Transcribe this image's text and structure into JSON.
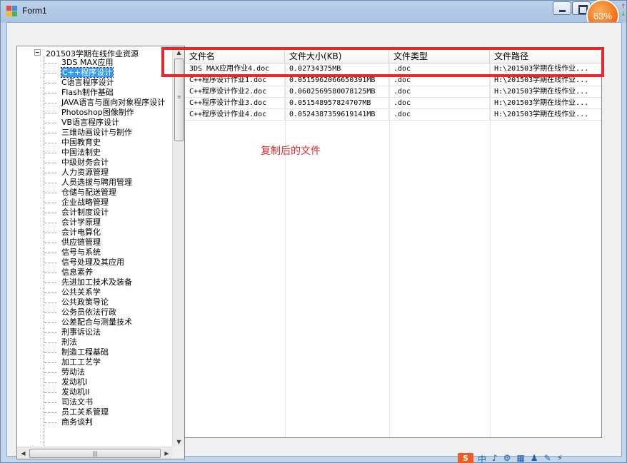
{
  "window": {
    "title": "Form1",
    "badge_percent": "63%"
  },
  "tree": {
    "root": "201503学期在线作业资源",
    "items": [
      "3DS MAX应用",
      "C++程序设计",
      "C语言程序设计",
      "Flash制作基础",
      "JAVA语言与面向对象程序设计",
      "Photoshop图像制作",
      "VB语言程序设计",
      "三维动画设计与制作",
      "中国教育史",
      "中国法制史",
      "中级财务会计",
      "人力资源管理",
      "人员选拔与聘用管理",
      "仓储与配送管理",
      "企业战略管理",
      "会计制度设计",
      "会计学原理",
      "会计电算化",
      "供应链管理",
      "信号与系统",
      "信号处理及其应用",
      "信息素养",
      "先进加工技术及装备",
      "公共关系学",
      "公共政策导论",
      "公务员依法行政",
      "公差配合与测量技术",
      "刑事诉讼法",
      "刑法",
      "制造工程基础",
      "加工工艺学",
      "劳动法",
      "发动机I",
      "发动机II",
      "司法文书",
      "员工关系管理",
      "商务谈判"
    ],
    "selected_index": 1
  },
  "grid": {
    "columns": [
      "文件名",
      "文件大小(KB)",
      "文件类型",
      "文件路径"
    ],
    "rows": [
      [
        "3DS MAX应用作业4.doc",
        "0.02734375MB",
        ".doc",
        "H:\\201503学期在线作业..."
      ],
      [
        "C++程序设计作业1.doc",
        "0.0515962066650391MB",
        ".doc",
        "H:\\201503学期在线作业..."
      ],
      [
        "C++程序设计作业2.doc",
        "0.0602569580078125MB",
        ".doc",
        "H:\\201503学期在线作业..."
      ],
      [
        "C++程序设计作业3.doc",
        "0.051548957824707MB",
        ".doc",
        "H:\\201503学期在线作业..."
      ],
      [
        "C++程序设计作业4.doc",
        "0.0524387359619141MB",
        ".doc",
        "H:\\201503学期在线作业..."
      ]
    ]
  },
  "annotation": "复制后的文件",
  "colors": {
    "highlight": "#e8262b",
    "selection": "#3399ff"
  },
  "taskbar": [
    "中",
    "♪",
    "⚙",
    "▦",
    "♟",
    "✎",
    "⚡"
  ]
}
